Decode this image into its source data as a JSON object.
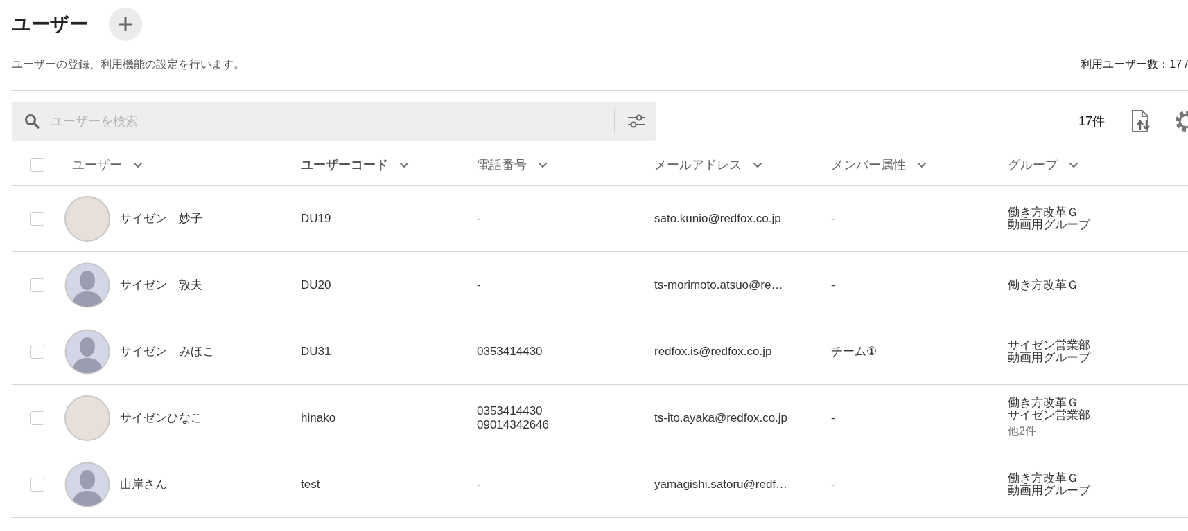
{
  "page": {
    "title": "ユーザー",
    "description": "ユーザーの登録、利用機能の設定を行います。",
    "usage": "利用ユーザー数：17 /"
  },
  "search": {
    "placeholder": "ユーザーを検索"
  },
  "toolbar": {
    "count": "17件"
  },
  "table": {
    "select_all_checked": false,
    "columns": [
      {
        "label": "ユーザー",
        "active": false
      },
      {
        "label": "ユーザーコード",
        "active": true
      },
      {
        "label": "電話番号",
        "active": false
      },
      {
        "label": "メールアドレス",
        "active": false
      },
      {
        "label": "メンバー属性",
        "active": false
      },
      {
        "label": "グループ",
        "active": false
      }
    ],
    "rows": [
      {
        "checked": false,
        "photo": true,
        "name": "サイゼン　妙子",
        "code": "DU19",
        "phones": [
          "-"
        ],
        "email": "sato.kunio@redfox.co.jp",
        "member": "-",
        "groups": [
          "働き方改革Ｇ",
          "動画用グループ"
        ]
      },
      {
        "checked": false,
        "photo": false,
        "name": "サイゼン　敦夫",
        "code": "DU20",
        "phones": [
          "-"
        ],
        "email": "ts-morimoto.atsuo@re…",
        "member": "-",
        "groups": [
          "働き方改革Ｇ"
        ]
      },
      {
        "checked": false,
        "photo": false,
        "name": "サイゼン　みほこ",
        "code": "DU31",
        "phones": [
          "0353414430"
        ],
        "email": "redfox.is@redfox.co.jp",
        "member": "チーム①",
        "groups": [
          "サイゼン営業部",
          "動画用グループ"
        ]
      },
      {
        "checked": false,
        "photo": true,
        "name": "サイゼンひなこ",
        "code": "hinako",
        "phones": [
          "0353414430",
          "09014342646"
        ],
        "email": "ts-ito.ayaka@redfox.co.jp",
        "member": "-",
        "groups": [
          "働き方改革Ｇ",
          "サイゼン営業部"
        ],
        "more": "他2件"
      },
      {
        "checked": false,
        "photo": false,
        "name": "山岸さん",
        "code": "test",
        "phones": [
          "-"
        ],
        "email": "yamagishi.satoru@redf…",
        "member": "-",
        "groups": [
          "働き方改革Ｇ",
          "動画用グループ"
        ]
      }
    ]
  }
}
